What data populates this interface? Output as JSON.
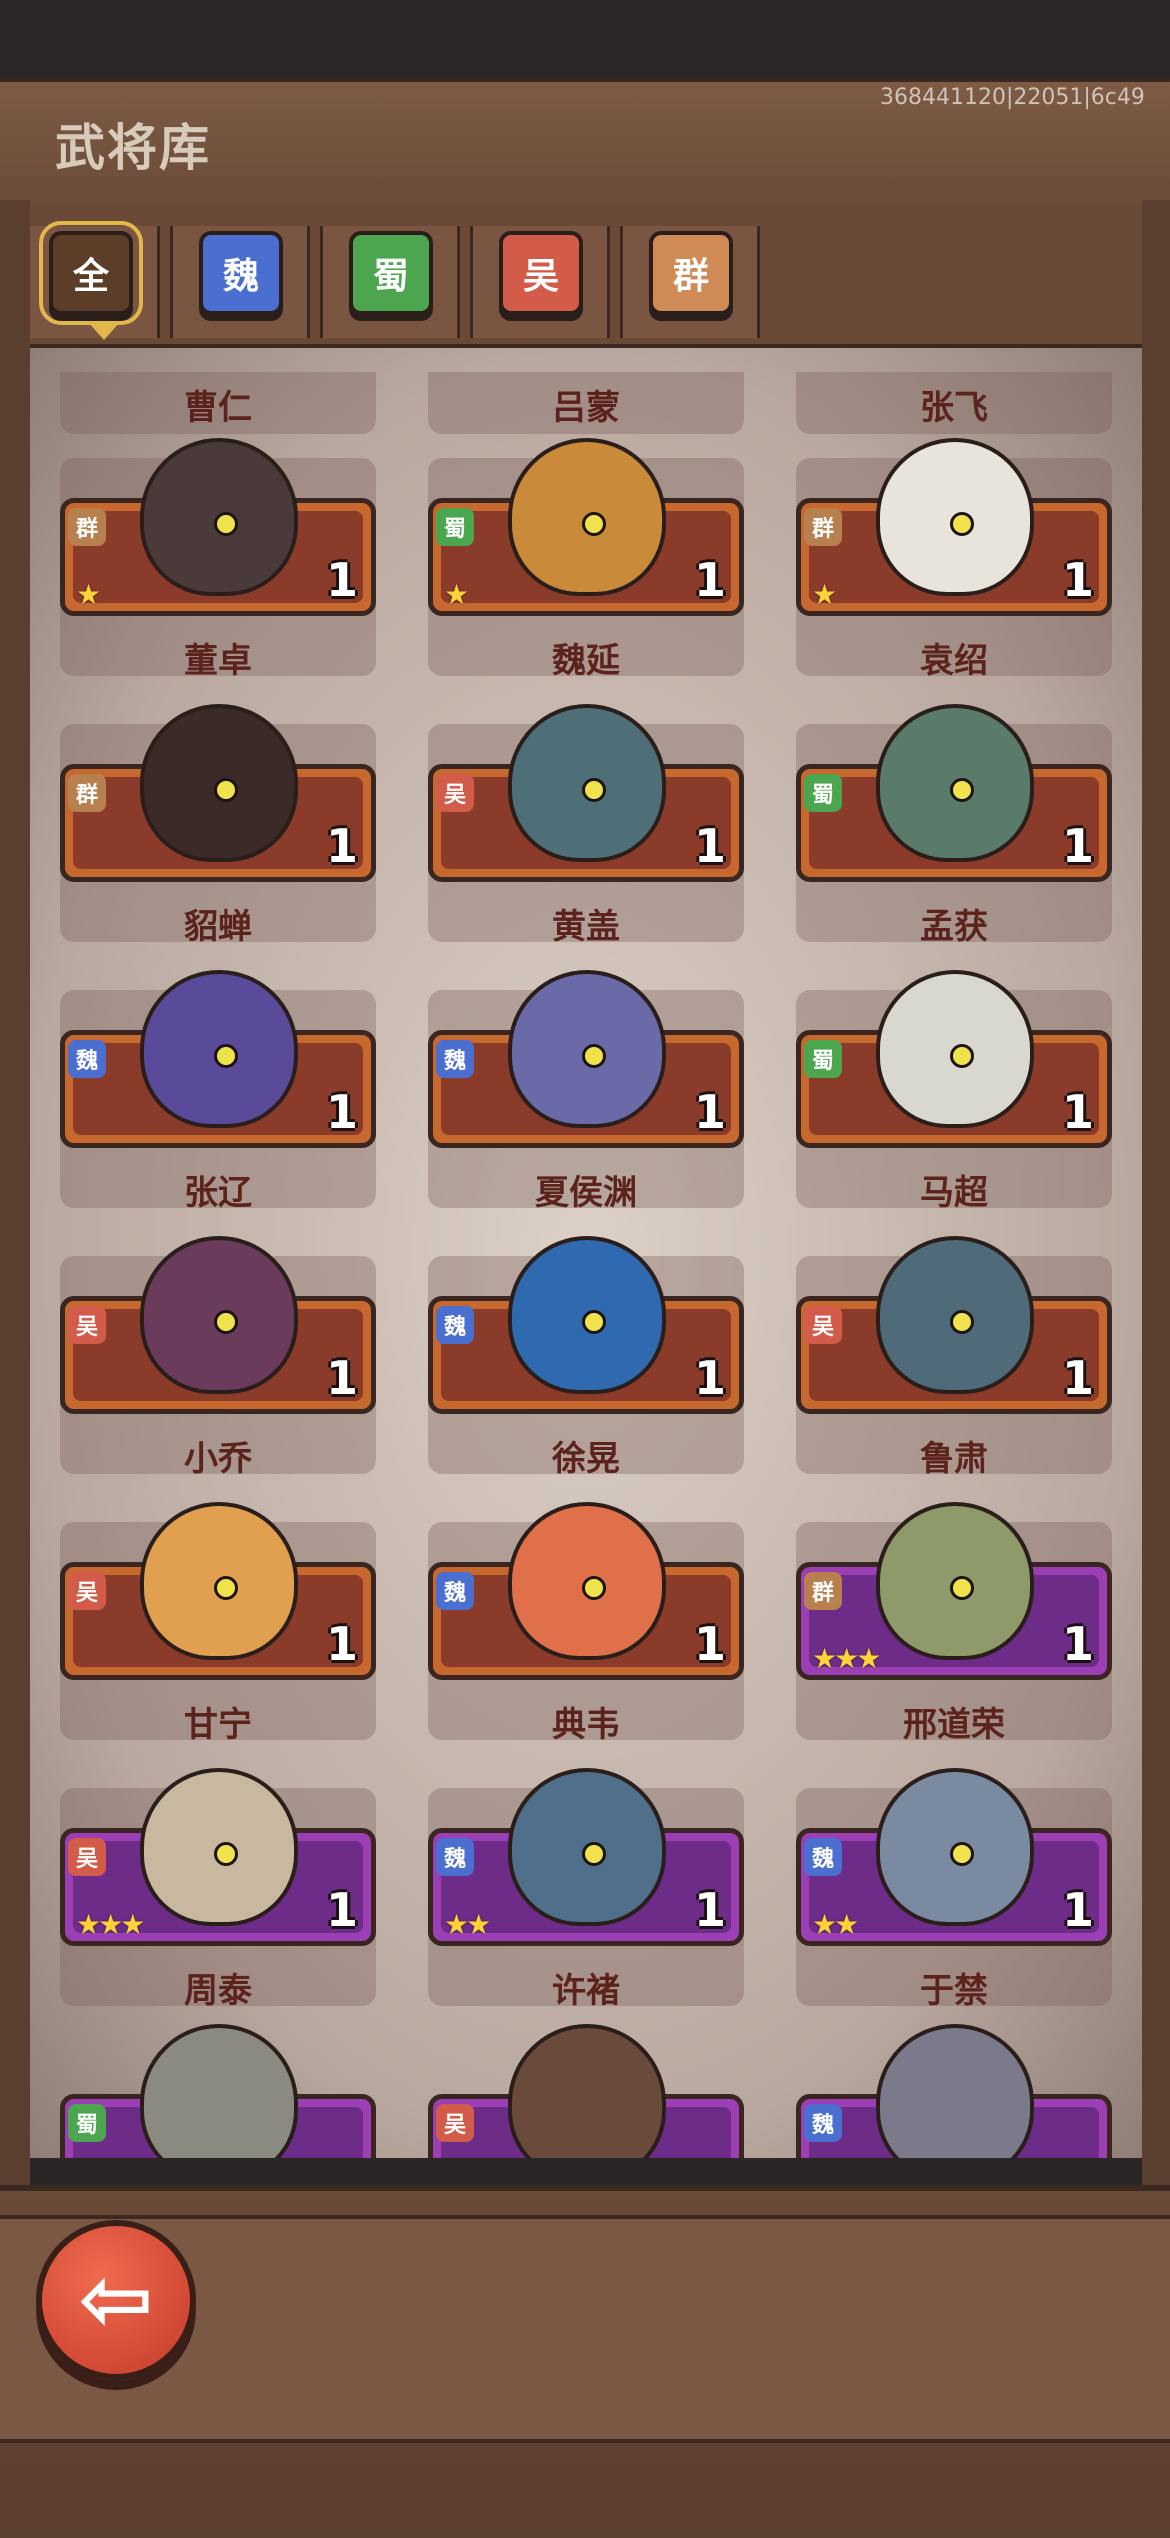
{
  "header": {
    "title": "武将库",
    "build_id": "368441120|22051|6c49"
  },
  "tabs": [
    {
      "label": "全",
      "selected": true
    },
    {
      "label": "魏",
      "selected": false
    },
    {
      "label": "蜀",
      "selected": false
    },
    {
      "label": "吴",
      "selected": false
    },
    {
      "label": "群",
      "selected": false
    }
  ],
  "partial_top_row": [
    "曹仁",
    "吕蒙",
    "张飞"
  ],
  "heroes": [
    {
      "name": "董卓",
      "faction": "群",
      "count": "1",
      "stars": "★",
      "tier": "orange"
    },
    {
      "name": "魏延",
      "faction": "蜀",
      "count": "1",
      "stars": "★",
      "tier": "orange"
    },
    {
      "name": "袁绍",
      "faction": "群",
      "count": "1",
      "stars": "★",
      "tier": "orange"
    },
    {
      "name": "貂蝉",
      "faction": "群",
      "count": "1",
      "stars": "",
      "tier": "orange"
    },
    {
      "name": "黄盖",
      "faction": "吴",
      "count": "1",
      "stars": "",
      "tier": "orange"
    },
    {
      "name": "孟获",
      "faction": "蜀",
      "count": "1",
      "stars": "",
      "tier": "orange"
    },
    {
      "name": "张辽",
      "faction": "魏",
      "count": "1",
      "stars": "",
      "tier": "orange"
    },
    {
      "name": "夏侯渊",
      "faction": "魏",
      "count": "1",
      "stars": "",
      "tier": "orange"
    },
    {
      "name": "马超",
      "faction": "蜀",
      "count": "1",
      "stars": "",
      "tier": "orange"
    },
    {
      "name": "小乔",
      "faction": "吴",
      "count": "1",
      "stars": "",
      "tier": "orange"
    },
    {
      "name": "徐晃",
      "faction": "魏",
      "count": "1",
      "stars": "",
      "tier": "orange"
    },
    {
      "name": "鲁肃",
      "faction": "吴",
      "count": "1",
      "stars": "",
      "tier": "orange"
    },
    {
      "name": "甘宁",
      "faction": "吴",
      "count": "1",
      "stars": "",
      "tier": "orange"
    },
    {
      "name": "典韦",
      "faction": "魏",
      "count": "1",
      "stars": "",
      "tier": "orange"
    },
    {
      "name": "邢道荣",
      "faction": "群",
      "count": "1",
      "stars": "★★★",
      "tier": "purple"
    },
    {
      "name": "周泰",
      "faction": "吴",
      "count": "1",
      "stars": "★★★",
      "tier": "purple"
    },
    {
      "name": "许褚",
      "faction": "魏",
      "count": "1",
      "stars": "★★",
      "tier": "purple"
    },
    {
      "name": "于禁",
      "faction": "魏",
      "count": "1",
      "stars": "★★",
      "tier": "purple"
    }
  ],
  "partial_bottom_row": [
    {
      "faction": "蜀"
    },
    {
      "faction": "吴"
    },
    {
      "faction": "魏"
    }
  ],
  "colors": {
    "wei": "#4b6fd0",
    "shu": "#4ca64f",
    "wu": "#d25c49",
    "qun": "#b8804e",
    "orange_tier": "#c7682f",
    "purple_tier": "#9c3fb5"
  }
}
